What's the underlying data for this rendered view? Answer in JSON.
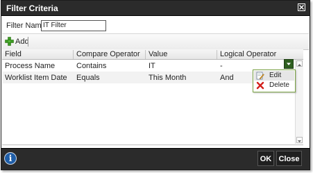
{
  "dialog": {
    "title": "Filter Criteria",
    "close_icon": "close-x-icon"
  },
  "filter_name": {
    "label": "Filter Name:",
    "value": "IT Filter"
  },
  "toolbar": {
    "add_label": "Add",
    "add_icon": "plus-icon",
    "add_icon_color": "#3c9b22"
  },
  "grid": {
    "columns": [
      "Field",
      "Compare Operator",
      "Value",
      "Logical Operator"
    ],
    "rows": [
      [
        "Process Name",
        "Contains",
        "IT",
        "-"
      ],
      [
        "Worklist Item Date",
        "Equals",
        "This Month",
        "And"
      ]
    ]
  },
  "context_menu": {
    "items": [
      {
        "label": "Edit",
        "icon": "edit-icon"
      },
      {
        "label": "Delete",
        "icon": "delete-icon"
      }
    ],
    "trigger_color": "#2e5f1f"
  },
  "footer": {
    "info_glyph": "i",
    "ok_label": "OK",
    "close_label": "Close"
  }
}
